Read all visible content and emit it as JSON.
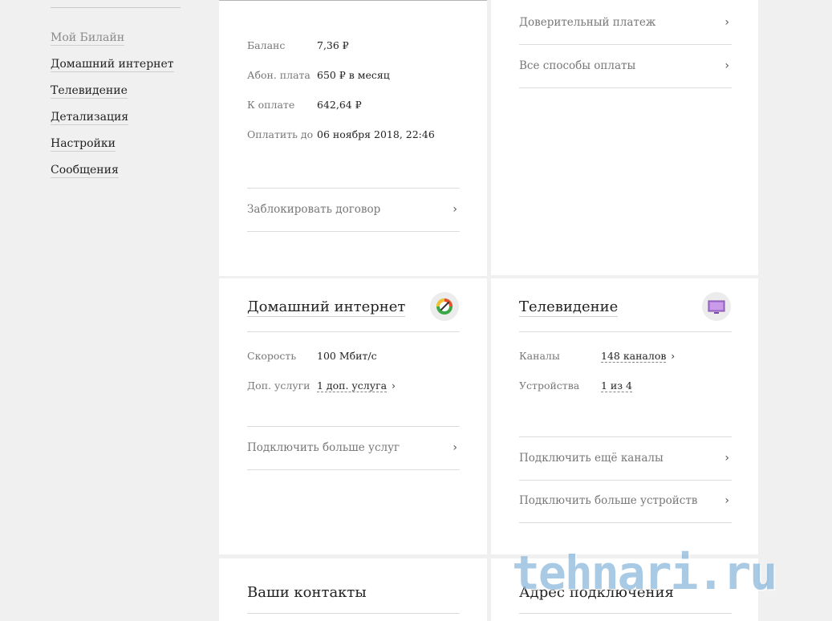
{
  "sidebar": {
    "items": [
      {
        "label": "Мой Билайн"
      },
      {
        "label": "Домашний интернет"
      },
      {
        "label": "Телевидение"
      },
      {
        "label": "Детализация"
      },
      {
        "label": "Настройки"
      },
      {
        "label": "Сообщения"
      }
    ]
  },
  "balance_card": {
    "rows": [
      {
        "label": "Баланс",
        "value": "7,36 ₽"
      },
      {
        "label": "Абон. плата",
        "value": "650 ₽ в месяц"
      },
      {
        "label": "К оплате",
        "value": "642,64 ₽"
      },
      {
        "label": "Оплатить до",
        "value": "06 ноября 2018, 22:46"
      }
    ],
    "block_link": "Заблокировать договор"
  },
  "payment_card": {
    "links": [
      "Доверительный платеж",
      "Все способы оплаты"
    ]
  },
  "internet_card": {
    "title": "Домашний интернет",
    "icon": "speedometer-icon",
    "speed_label": "Скорость",
    "speed_value": "100 Мбит/с",
    "extra_label": "Доп. услуги",
    "extra_value": "1 доп. услуга",
    "more_link": "Подключить больше услуг"
  },
  "tv_card": {
    "title": "Телевидение",
    "icon": "tv-icon",
    "channels_label": "Каналы",
    "channels_value": "148 каналов",
    "devices_label": "Устройства",
    "devices_value": "1 из 4",
    "links": [
      "Подключить ещё каналы",
      "Подключить больше устройств"
    ]
  },
  "contacts_card": {
    "title": "Ваши контакты"
  },
  "address_card": {
    "title": "Адрес подключения"
  },
  "chevron": "›",
  "watermark": "tehnari.ru"
}
